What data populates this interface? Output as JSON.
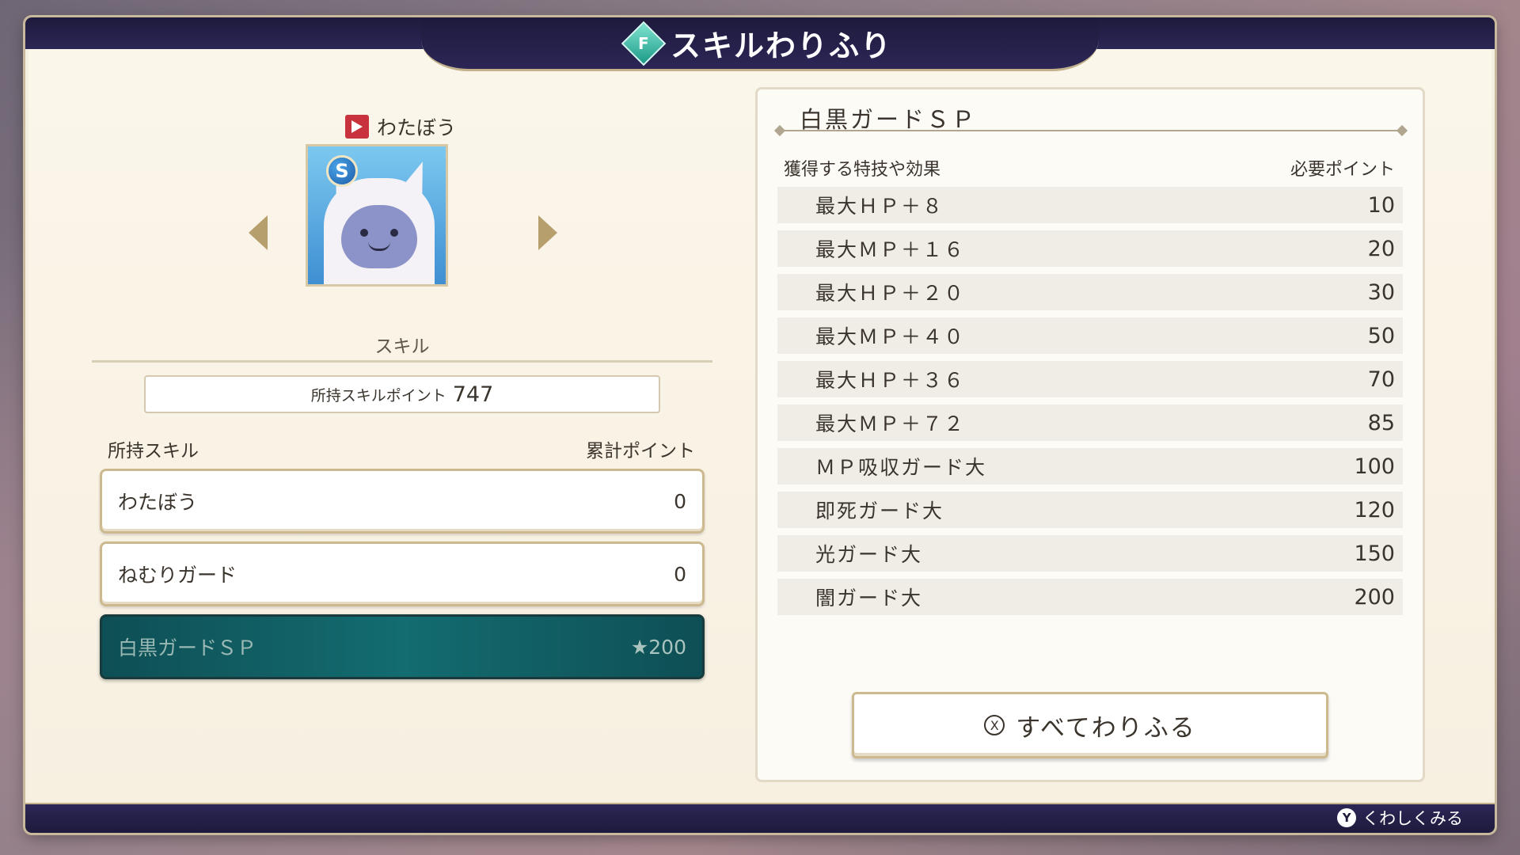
{
  "header": {
    "title": "スキルわりふり",
    "icon_glyph": "F"
  },
  "character": {
    "name": "わたぼう",
    "rank_badge": "S"
  },
  "skill_section": {
    "header": "スキル",
    "points_label": "所持スキルポイント",
    "points_value": "747",
    "list_head_left": "所持スキル",
    "list_head_right": "累計ポイント",
    "skills": [
      {
        "name": "わたぼう",
        "value": "0"
      },
      {
        "name": "ねむりガード",
        "value": "0"
      },
      {
        "name": "白黒ガードＳＰ",
        "value": "★200"
      }
    ]
  },
  "detail": {
    "title": "白黒ガードＳＰ",
    "head_left": "獲得する特技や効果",
    "head_right": "必要ポイント",
    "effects": [
      {
        "name": "最大ＨＰ＋８",
        "points": "10"
      },
      {
        "name": "最大ＭＰ＋１６",
        "points": "20"
      },
      {
        "name": "最大ＨＰ＋２０",
        "points": "30"
      },
      {
        "name": "最大ＭＰ＋４０",
        "points": "50"
      },
      {
        "name": "最大ＨＰ＋３６",
        "points": "70"
      },
      {
        "name": "最大ＭＰ＋７２",
        "points": "85"
      },
      {
        "name": "ＭＰ吸収ガード大",
        "points": "100"
      },
      {
        "name": "即死ガード大",
        "points": "120"
      },
      {
        "name": "光ガード大",
        "points": "150"
      },
      {
        "name": "闇ガード大",
        "points": "200"
      }
    ],
    "assign_all_label": "すべてわりふる",
    "assign_button_glyph": "X"
  },
  "footer": {
    "hint_button": "Y",
    "hint_label": "くわしくみる"
  },
  "colors": {
    "selected_row": "#136c70",
    "frame_bar": "#1e1a3c",
    "accent_gold": "#cdb98f"
  }
}
